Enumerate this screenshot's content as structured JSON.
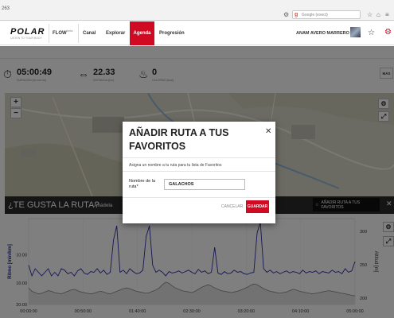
{
  "browser": {
    "url_fragment": "263",
    "search_placeholder": "Google (exect)"
  },
  "nav": {
    "logo": "POLAR",
    "logo_tagline": "LISTEN TO YOUR BODY",
    "flow": "FLOW",
    "flow_sup": "beta",
    "items": [
      "Canal",
      "Explorar",
      "Agenda",
      "Progresión"
    ],
    "active": "Agenda",
    "user_name": "ANAM AVERO MARRERO"
  },
  "stats": [
    {
      "icon": "stopwatch-icon",
      "value": "05:00:49",
      "label": "DURACIÓN [hh:mm:ss]"
    },
    {
      "icon": "distance-icon",
      "value": "22.33",
      "label": "DISTANCIA [km]"
    },
    {
      "icon": "flame-icon",
      "value": "0",
      "label": "CALORÍAS [kcal]"
    }
  ],
  "more_button": "MÁS",
  "banner": {
    "title": "¿TE GUSTA LA RUTA?",
    "subtitle": "Añádela",
    "fav_button": "AÑADIR RUTA A TUS FAVORITOS"
  },
  "modal": {
    "title": "AÑADIR RUTA A TUS FAVORITOS",
    "description": "Asigna un nombre a tu ruta para tu lista de Favoritos",
    "route_label": "Nombre de la ruta",
    "route_required": "*",
    "route_value": "GALACHOS",
    "cancel": "CANCELAR",
    "save": "GUARDAR"
  },
  "chart_data": {
    "type": "line",
    "ylabel_left": "Ritmo [min/km]",
    "ylabel_right": "Altitud [m]",
    "x_ticks": [
      "00:00:00",
      "00:50:00",
      "01:40:00",
      "02:30:00",
      "03:20:00",
      "04:10:00",
      "05:00:00"
    ],
    "y_left_ticks": [
      "10:00",
      "16:00",
      "20:00"
    ],
    "y_right_ticks": [
      "300",
      "250",
      "200"
    ],
    "series": [
      {
        "name": "Ritmo",
        "color": "#2a2aa8",
        "values": [
          13.5,
          12,
          13,
          12.5,
          12,
          12.5,
          13,
          12,
          12.5,
          12,
          13,
          12.8,
          12.3,
          12.5,
          12,
          12.7,
          13,
          12.4,
          12.2,
          12.6,
          12.5,
          13,
          12.4,
          12.8,
          12.2,
          12.5,
          17,
          19,
          12.5,
          12.8,
          12.3,
          13,
          12.6,
          12.3,
          12.4,
          12.8,
          17.5,
          19,
          13.5,
          12.5,
          12.8,
          12.5,
          12,
          12.6,
          12.4,
          12.5,
          12.7,
          12.4,
          12.6,
          12.8,
          12.5,
          12.3,
          12.9,
          12.5,
          12.7,
          12.3,
          12.5,
          16,
          12.4,
          12.2,
          12.6,
          12.3,
          12.4,
          12.8,
          12.5,
          12.6,
          12.3,
          12.2,
          12.4,
          12.5,
          18,
          19.5,
          13,
          12.5,
          12.8,
          12.4,
          12.6,
          12.3,
          12.5,
          12.7,
          12.4,
          12.6,
          12.5,
          12.3,
          12.8,
          12.4,
          12.6,
          12.5,
          12.7,
          12.3,
          12.6,
          12.5,
          12.4,
          12.8,
          12.5,
          12.6,
          12.3,
          13,
          12.5,
          12.7,
          14
        ]
      },
      {
        "name": "Altitud",
        "color": "#888888",
        "values": [
          205,
          200,
          198,
          196,
          197,
          199,
          201,
          200,
          198,
          197,
          196,
          198,
          200,
          202,
          203,
          201,
          199,
          198,
          197,
          196,
          197,
          199,
          200,
          199,
          197,
          196,
          198,
          200,
          202,
          204,
          205,
          204,
          202,
          200,
          199,
          198,
          197,
          198,
          200,
          202,
          205,
          210,
          214,
          212,
          208,
          205,
          203,
          201,
          200,
          199,
          198,
          200,
          203,
          206,
          208,
          210,
          208,
          205,
          203,
          201,
          200,
          199,
          198,
          199,
          200,
          202,
          204,
          206,
          209,
          211,
          210,
          207,
          204,
          202,
          200,
          199,
          198,
          197,
          198,
          199,
          201,
          203,
          202,
          200,
          199,
          198,
          197,
          196,
          197,
          198,
          199,
          200,
          201,
          200,
          199,
          198,
          197,
          196,
          195,
          194,
          193
        ]
      }
    ],
    "ylim_left": [
      8,
      20
    ],
    "ylim_right": [
      180,
      310
    ]
  }
}
